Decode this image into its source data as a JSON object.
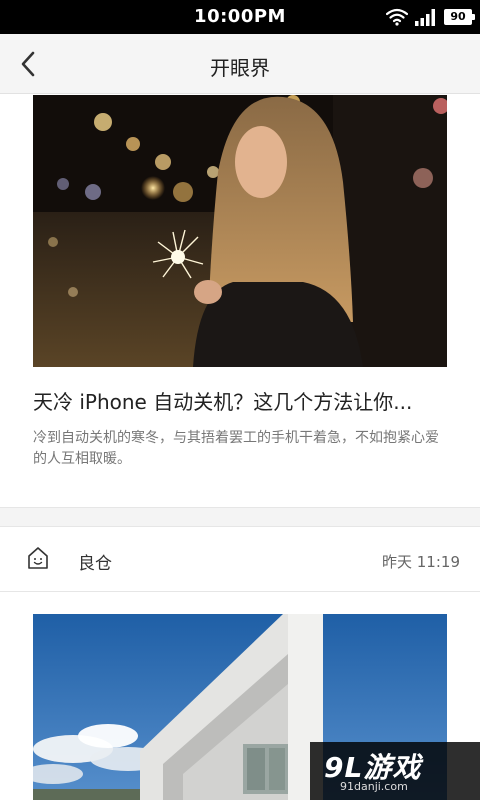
{
  "status_bar": {
    "time": "10:00PM",
    "battery_level": "90",
    "icons": [
      "wifi-icon",
      "signal-icon",
      "battery-icon"
    ]
  },
  "nav": {
    "title": "开眼界",
    "back_icon": "chevron-left-icon"
  },
  "article_1": {
    "image": "photo of a woman holding a sparkler at night",
    "title": "天冷 iPhone 自动关机？这几个方法让你...",
    "description": "冷到自动关机的寒冬，与其捂着罢工的手机干着急，不如抱紧心爱的人互相取暖。"
  },
  "author": {
    "avatar_icon": "house-smile-icon",
    "name": "良仓",
    "time": "昨天 11:19"
  },
  "article_2": {
    "image": "white modern building under blue sky"
  },
  "watermark": {
    "logo": "9L游戏",
    "url": "91danji.com"
  },
  "colors": {
    "status_bar": "#000000",
    "nav_bar": "#f5f5f5",
    "title_text": "#222222",
    "desc_text": "#777777",
    "divider": "#e6e6e6"
  }
}
